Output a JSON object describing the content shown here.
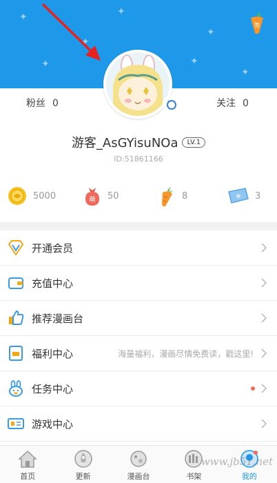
{
  "header": {
    "accent_color": "#1e98e8",
    "top_right_icon": "carrot-badge-icon"
  },
  "profile": {
    "fans_label": "粉丝",
    "fans_count": "0",
    "follow_label": "关注",
    "follow_count": "0",
    "username": "游客_AsGYisuNOa",
    "level": "LV.1",
    "user_id": "ID:51861166"
  },
  "assets": [
    {
      "icon": "coin-icon",
      "value": "5000"
    },
    {
      "icon": "meng-bag-icon",
      "value": "50"
    },
    {
      "icon": "carrot-icon",
      "value": "8"
    },
    {
      "icon": "ticket-icon",
      "value": "3"
    }
  ],
  "menu": [
    {
      "icon": "diamond-vip-icon",
      "label": "开通会员",
      "hint": ""
    },
    {
      "icon": "wallet-icon",
      "label": "充值中心",
      "hint": ""
    },
    {
      "icon": "thumbs-up-icon",
      "label": "推荐漫画台",
      "hint": ""
    },
    {
      "icon": "gift-envelope-icon",
      "label": "福利中心",
      "hint": "海量福利，漫画尽情免费读，戳这里!"
    },
    {
      "icon": "rabbit-task-icon",
      "label": "任务中心",
      "hint": ""
    },
    {
      "icon": "game-ticket-icon",
      "label": "游戏中心",
      "hint": ""
    }
  ],
  "tabs": [
    {
      "icon": "home-icon",
      "label": "首页"
    },
    {
      "icon": "rocket-icon",
      "label": "更新"
    },
    {
      "icon": "planet-icon",
      "label": "漫画台"
    },
    {
      "icon": "bookshelf-icon",
      "label": "书架"
    },
    {
      "icon": "profile-icon",
      "label": "我的"
    }
  ],
  "watermark": "www.jb51.net"
}
